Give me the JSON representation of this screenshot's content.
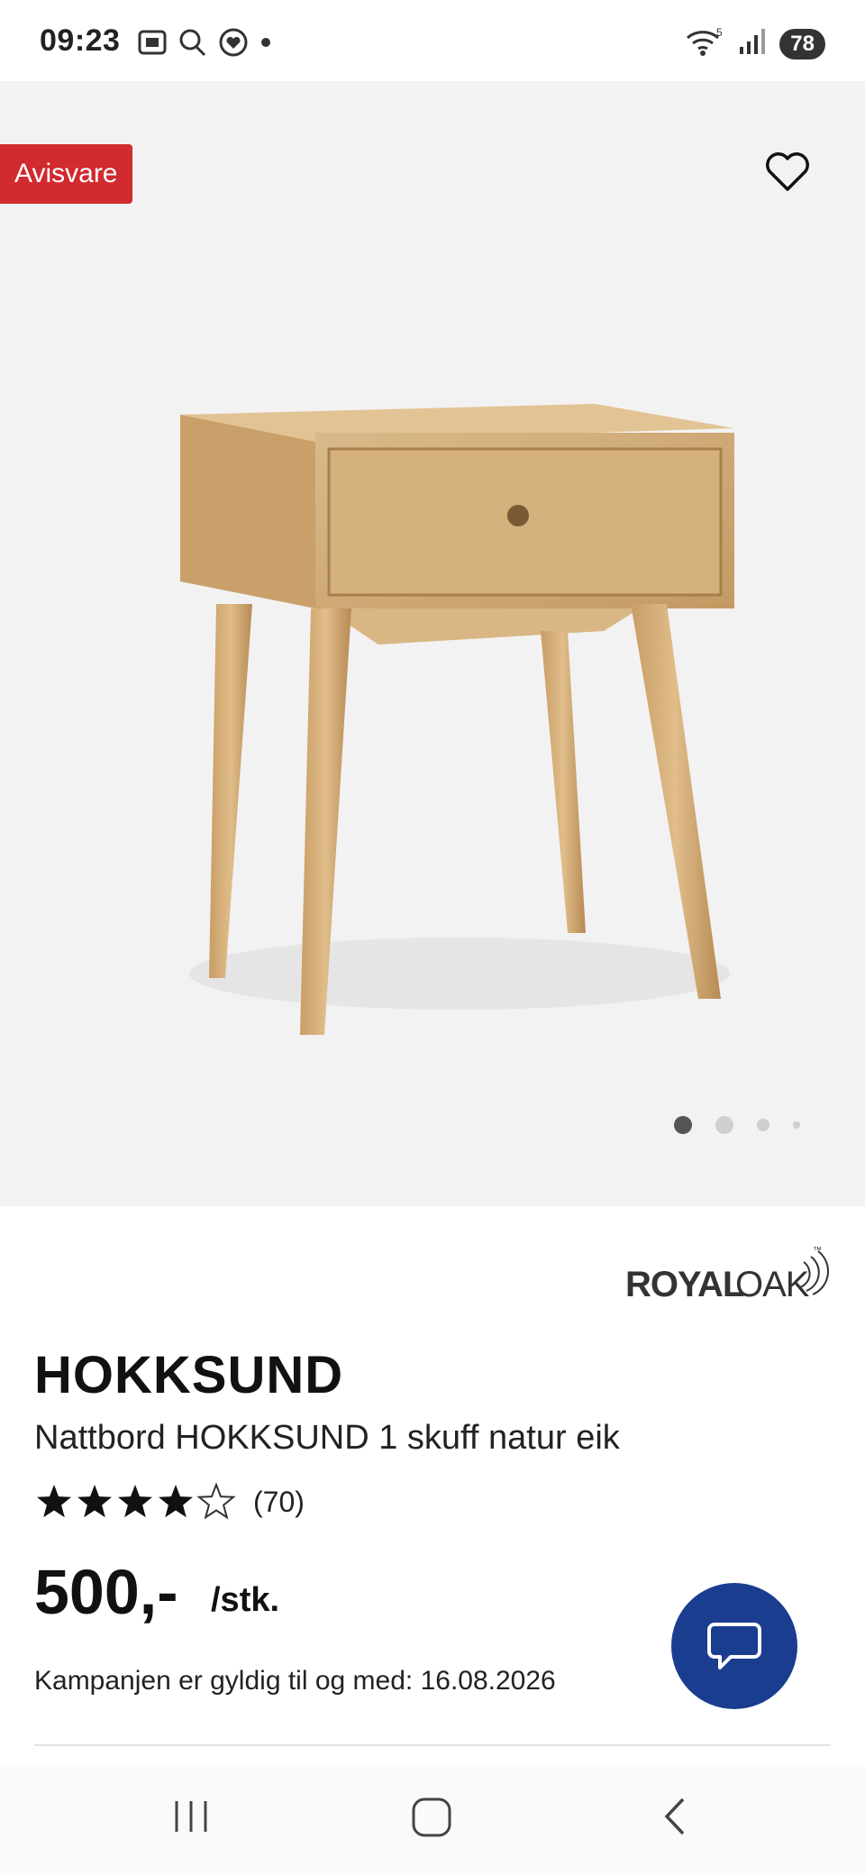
{
  "status_bar": {
    "time": "09:23",
    "wifi_label": "5",
    "battery": "78"
  },
  "product": {
    "badge": "Avisvare",
    "brand_name": "ROYALOAK",
    "brand_part1": "ROYAL",
    "brand_part2": "OAK",
    "brand_tm": "™",
    "title": "HOKKSUND",
    "subtitle": "Nattbord HOKKSUND 1 skuff natur eik",
    "rating": 4,
    "rating_max": 5,
    "rating_count": "(70)",
    "price": "500,-",
    "unit": "/stk.",
    "campaign": "Kampanjen er gyldig til og med: 16.08.2026"
  },
  "carousel": {
    "slides": 4,
    "active_index": 0
  },
  "icons": {
    "favorite": "heart-outline-icon",
    "chat": "chat-bubble-icon",
    "nav_recent": "recent-apps-icon",
    "nav_home": "home-icon",
    "nav_back": "back-icon"
  },
  "colors": {
    "badge_bg": "#d12a2f",
    "chat_bg": "#1a3d8f",
    "hero_bg": "#f3f2f2"
  }
}
